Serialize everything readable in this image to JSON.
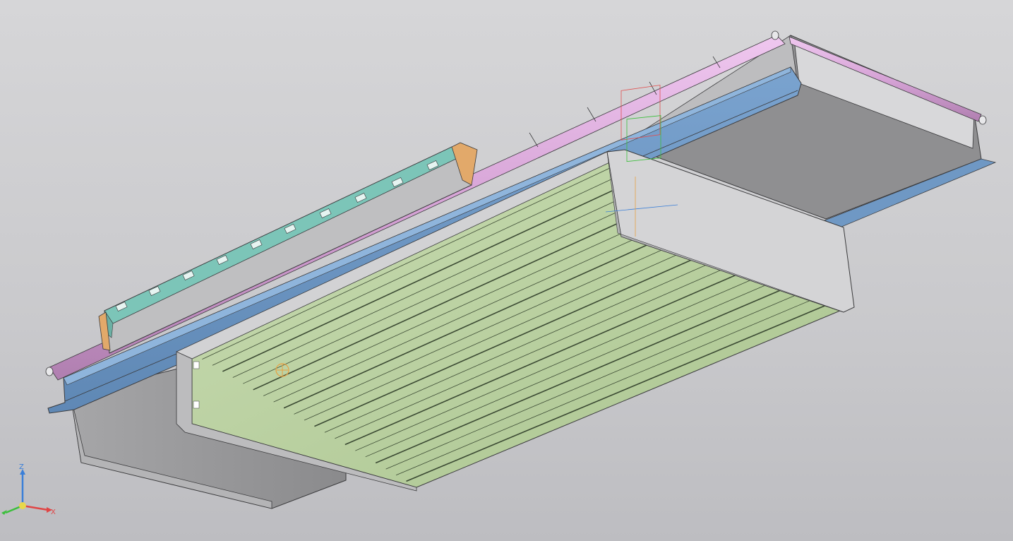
{
  "viewport": {
    "background_top": "#d6d6d8",
    "background_bottom": "#bdbdc1"
  },
  "model": {
    "colors": {
      "mounting_rail": "#6f98c4",
      "mounting_rail_dark": "#5a80aa",
      "bracket_strip": "#7cc5b8",
      "hinge_tube": "#d6a3d6",
      "end_plate": "#e2a96a",
      "louvers": "#bcd3a5",
      "louver_lines": "#3b4a33",
      "housing_grey": "#cfcfd1",
      "housing_dark": "#8e8e90",
      "edge": "#3a3a3c"
    }
  },
  "axis_triad": {
    "z_label": "Z",
    "x_label": "X",
    "y_label": "Y",
    "x_color": "#e04646",
    "y_color": "#3cbf3c",
    "z_color": "#3a7fd8",
    "origin_color": "#e8d84a"
  }
}
